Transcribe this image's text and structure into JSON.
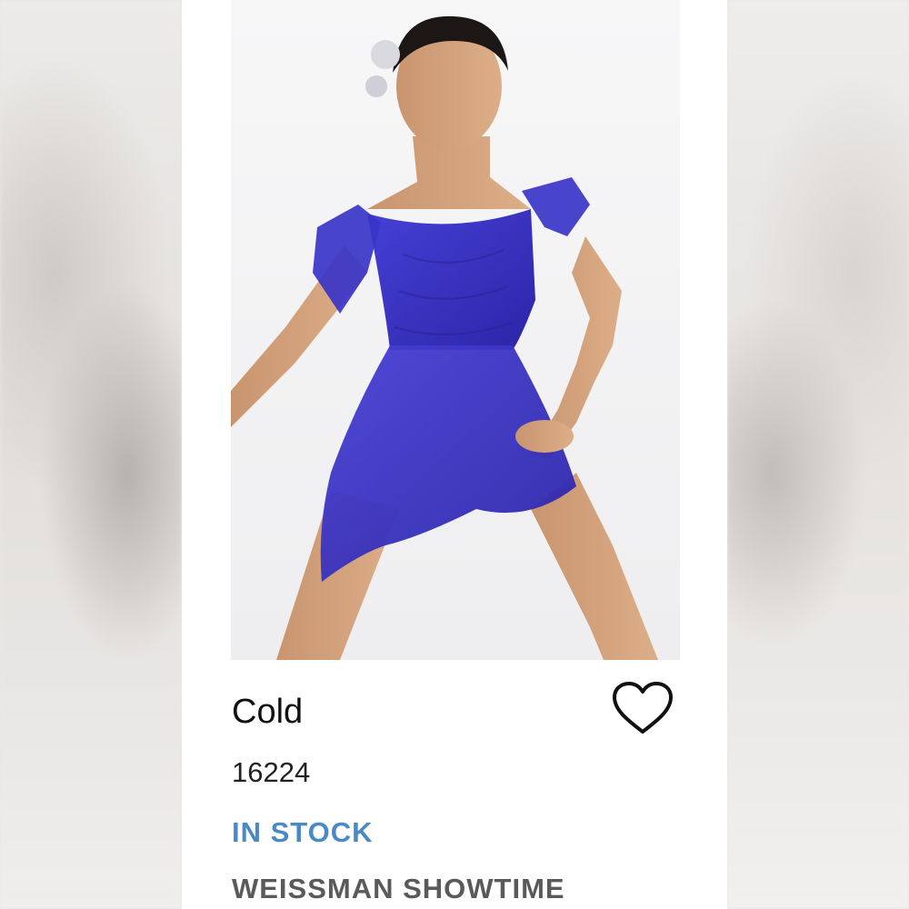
{
  "product": {
    "name": "Cold",
    "sku": "16224",
    "stock_status": "IN STOCK",
    "brand": "WEISSMAN SHOWTIME"
  },
  "icons": {
    "wishlist": "heart-outline-icon"
  },
  "colors": {
    "stock_status": "#4a8ac4",
    "brand": "#5a5a5a",
    "dress": "#3b35c4",
    "page_background": "#ffffff"
  }
}
